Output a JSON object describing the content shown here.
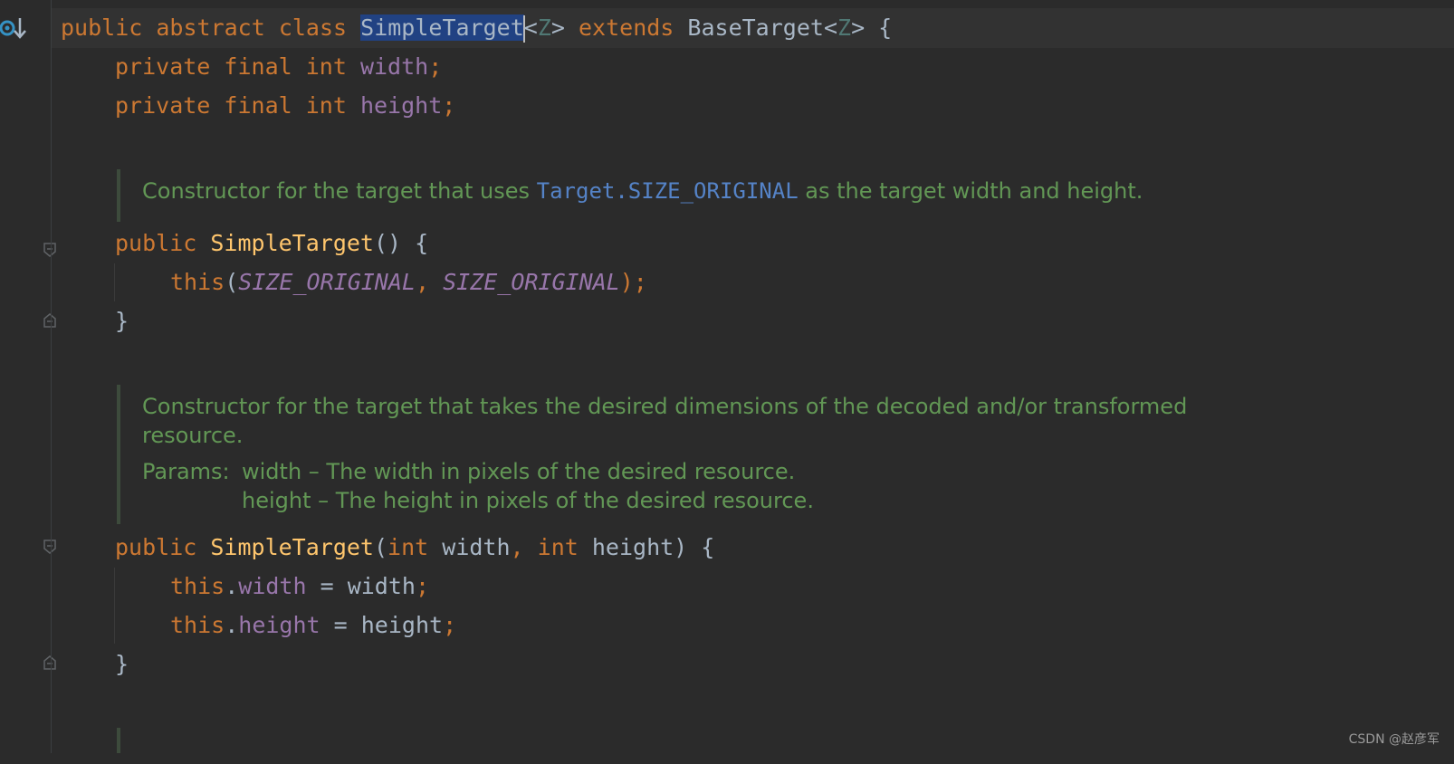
{
  "editor": {
    "line1": {
      "kw1": "public abstract class ",
      "selected": "SimpleTarget",
      "gen_open": "<",
      "gen_var1": "Z",
      "gen_close": "> ",
      "kw2": "extends ",
      "base": "BaseTarget",
      "gen2_open": "<",
      "gen_var2": "Z",
      "gen2_close": "> {"
    },
    "field_width": {
      "kw": "private final int ",
      "name": "width",
      "end": ";"
    },
    "field_height": {
      "kw": "private final int ",
      "name": "height",
      "end": ";"
    },
    "doc1": {
      "before": "Constructor for the target that uses ",
      "link": "Target.SIZE_ORIGINAL",
      "after": " as the target width and height."
    },
    "ctor1": {
      "kw": "public ",
      "name": "SimpleTarget",
      "rest": "() {",
      "body_this": "this",
      "body_open": "(",
      "arg1": "SIZE_ORIGINAL",
      "comma": ", ",
      "arg2": "SIZE_ORIGINAL",
      "body_close": ");",
      "close": "}"
    },
    "doc2": {
      "line1": "Constructor for the target that takes the desired dimensions of the decoded and/or transformed",
      "line2": "resource.",
      "params_label": "Params:",
      "param1": "width – The width in pixels of the desired resource.",
      "param2": "height – The height in pixels of the desired resource."
    },
    "ctor2": {
      "kw": "public ",
      "name": "SimpleTarget",
      "open": "(",
      "t1": "int ",
      "p1": "width",
      "comma": ", ",
      "t2": "int ",
      "p2": "height",
      "rest": ") {",
      "s1_this": "this",
      "s1_dot": ".",
      "s1_field": "width",
      "s1_eq": " = width",
      "s1_end": ";",
      "s2_this": "this",
      "s2_dot": ".",
      "s2_field": "height",
      "s2_eq": " = height",
      "s2_end": ";",
      "close": "}"
    }
  },
  "watermark": "CSDN @赵彦军",
  "colors": {
    "background": "#2b2b2b",
    "keyword": "#cc7832",
    "function": "#ffc66d",
    "field": "#9876aa",
    "doc": "#629755",
    "doc_link": "#5583c7",
    "selection": "#214283"
  },
  "icons": [
    "override-marker-icon",
    "fold-icon"
  ]
}
